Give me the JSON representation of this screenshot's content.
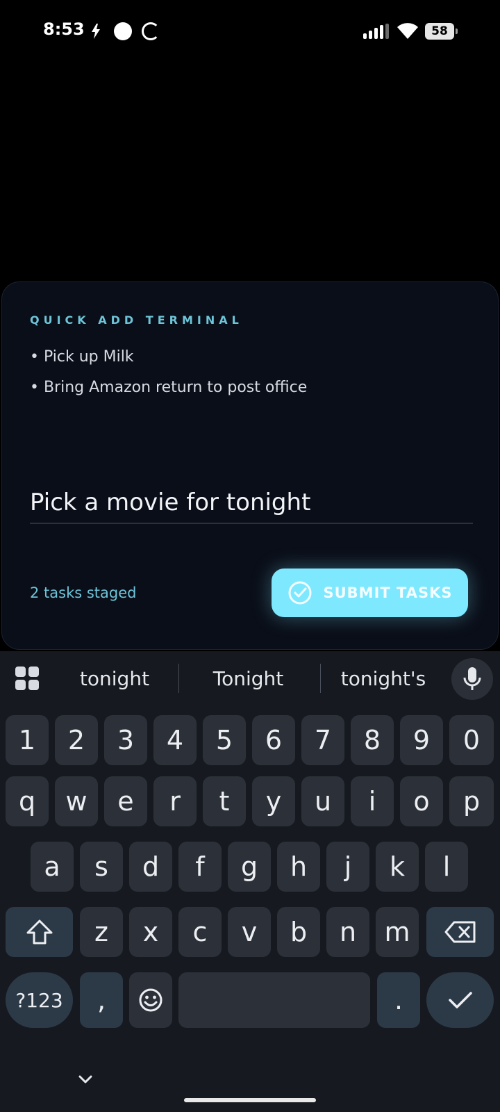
{
  "status_bar": {
    "time": "8:53",
    "battery": "58",
    "icons": [
      "flash-icon",
      "circle-full-icon",
      "circle-loading-icon",
      "signal-icon",
      "wifi-icon",
      "battery-icon"
    ]
  },
  "card": {
    "title": "QUICK ADD TERMINAL",
    "staged": [
      "• Pick up Milk",
      "• Bring Amazon return to post office"
    ],
    "input_value": "Pick a movie for tonight",
    "tasks_count": "2 tasks staged",
    "submit_label": "SUBMIT TASKS",
    "accent": "#7ee8ff"
  },
  "keyboard": {
    "suggestions": [
      "tonight",
      "Tonight",
      "tonight's"
    ],
    "row_numbers": [
      "1",
      "2",
      "3",
      "4",
      "5",
      "6",
      "7",
      "8",
      "9",
      "0"
    ],
    "row_top": [
      "q",
      "w",
      "e",
      "r",
      "t",
      "y",
      "u",
      "i",
      "o",
      "p"
    ],
    "row_middle": [
      "a",
      "s",
      "d",
      "f",
      "g",
      "h",
      "j",
      "k",
      "l"
    ],
    "row_bottom": [
      "z",
      "x",
      "c",
      "v",
      "b",
      "n",
      "m"
    ],
    "symbols_label": "?123",
    "comma": ",",
    "period": "."
  }
}
